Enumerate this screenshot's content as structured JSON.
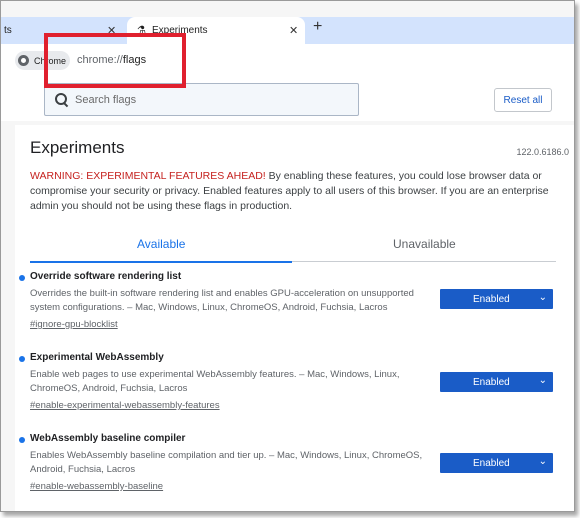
{
  "tabs": [
    {
      "label": "ts",
      "close": "✕"
    },
    {
      "label": "Experiments",
      "close": "✕"
    }
  ],
  "new_tab": "+",
  "toolbar": {
    "chip_label": "Chrome",
    "url_scheme": "chrome://",
    "url_path": "flags"
  },
  "search": {
    "placeholder": "Search flags"
  },
  "reset_label": "Reset all",
  "page": {
    "title": "Experiments",
    "version": "122.0.6186.0",
    "warning_prefix": "WARNING: EXPERIMENTAL FEATURES AHEAD!",
    "warning_body": " By enabling these features, you could lose browser data or compromise your security or privacy. Enabled features apply to all users of this browser. If you are an enterprise admin you should not be using these flags in production."
  },
  "filter_tabs": {
    "available": "Available",
    "unavailable": "Unavailable"
  },
  "flags": [
    {
      "name": "Override software rendering list",
      "description": "Overrides the built-in software rendering list and enables GPU-acceleration on unsupported system configurations. – Mac, Windows, Linux, ChromeOS, Android, Fuchsia, Lacros",
      "hash": "#ignore-gpu-blocklist",
      "value": "Enabled"
    },
    {
      "name": "Experimental WebAssembly",
      "description": "Enable web pages to use experimental WebAssembly features. – Mac, Windows, Linux, ChromeOS, Android, Fuchsia, Lacros",
      "hash": "#enable-experimental-webassembly-features",
      "value": "Enabled"
    },
    {
      "name": "WebAssembly baseline compiler",
      "description": "Enables WebAssembly baseline compilation and tier up. – Mac, Windows, Linux, ChromeOS, Android, Fuchsia, Lacros",
      "hash": "#enable-webassembly-baseline",
      "value": "Enabled"
    }
  ],
  "colors": {
    "accent": "#1a73e8",
    "select_bg": "#1a5cc7",
    "warning": "#c5221f",
    "highlight": "#e0202e"
  }
}
